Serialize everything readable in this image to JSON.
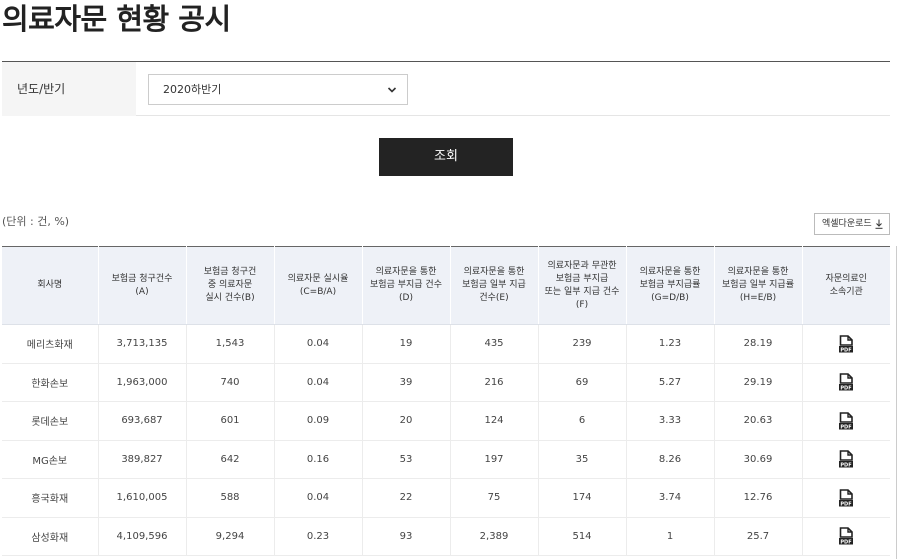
{
  "page": {
    "title": "의료자문 현황 공시"
  },
  "filter": {
    "label": "년도/반기",
    "selected": "2020하반기"
  },
  "search_button": "조회",
  "unit_note": "(단위 : 건, %)",
  "excel_button": "엑셀다운로드",
  "table": {
    "headers": [
      "회사명",
      "보험금 청구건수\n(A)",
      "보험금 청구건\n중 의료자문\n실시 건수(B)",
      "의료자문 실시율\n(C=B/A)",
      "의료자문을 통한\n보험금 부지급 건수\n(D)",
      "의료자문을 통한\n보험금 일부 지급\n건수(E)",
      "의료자문과 무관한\n보험금 부지급\n또는 일부 지급 건수\n(F)",
      "의료자문을 통한\n보험금 부지급률\n(G=D/B)",
      "의료자문을 통한\n보험금 일부 지급률\n(H=E/B)",
      "자문의료인\n소속기관"
    ],
    "rows": [
      [
        "메리츠화재",
        "3,713,135",
        "1,543",
        "0.04",
        "19",
        "435",
        "239",
        "1.23",
        "28.19"
      ],
      [
        "한화손보",
        "1,963,000",
        "740",
        "0.04",
        "39",
        "216",
        "69",
        "5.27",
        "29.19"
      ],
      [
        "롯데손보",
        "693,687",
        "601",
        "0.09",
        "20",
        "124",
        "6",
        "3.33",
        "20.63"
      ],
      [
        "MG손보",
        "389,827",
        "642",
        "0.16",
        "53",
        "197",
        "35",
        "8.26",
        "30.69"
      ],
      [
        "흥국화재",
        "1,610,005",
        "588",
        "0.04",
        "22",
        "75",
        "174",
        "3.74",
        "12.76"
      ],
      [
        "삼성화재",
        "4,109,596",
        "9,294",
        "0.23",
        "93",
        "2,389",
        "514",
        "1",
        "25.7"
      ]
    ],
    "pdf_icon": "pdf-file-icon"
  }
}
